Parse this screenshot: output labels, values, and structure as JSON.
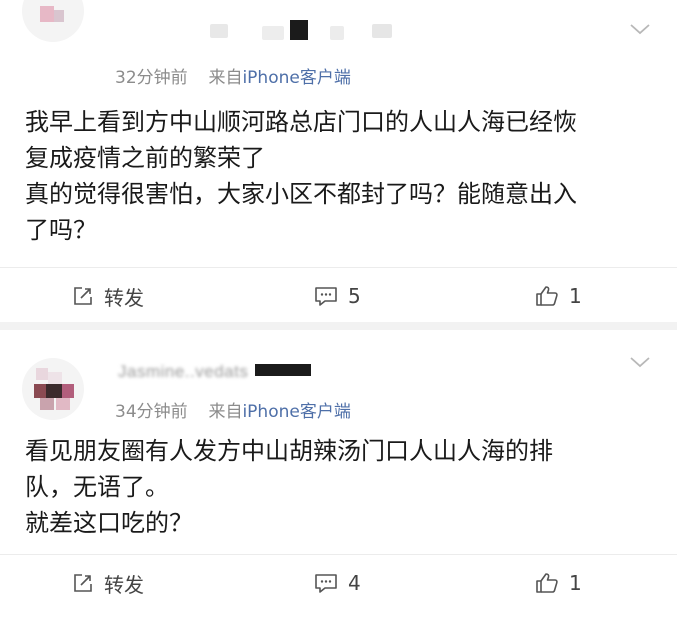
{
  "posts": [
    {
      "time": "32分钟前",
      "source_prefix": "来自",
      "client": "iPhone客户端",
      "content_lines": [
        "我早上看到方中山顺河路总店门口的人山人海已经恢",
        "复成疫情之前的繁荣了",
        "真的觉得很害怕，大家小区不都封了吗？能随意出入",
        "了吗？"
      ],
      "repost_label": "转发",
      "comment_count": "5",
      "like_count": "1"
    },
    {
      "username": "Jasmine..vedats",
      "time": "34分钟前",
      "source_prefix": "来自",
      "client": "iPhone客户端",
      "content_lines": [
        "看见朋友圈有人发方中山胡辣汤门口人山人海的排",
        "队，无语了。",
        "就差这口吃的？"
      ],
      "repost_label": "转发",
      "comment_count": "4",
      "like_count": "1"
    }
  ],
  "icons": {
    "repost": "repost-icon",
    "comment": "comment-icon",
    "like": "thumbs-up-icon",
    "menu": "chevron-down-icon"
  },
  "colors": {
    "client_link": "#4e6fa8",
    "meta_gray": "#8c8c8c",
    "divider": "#f2f2f2"
  }
}
